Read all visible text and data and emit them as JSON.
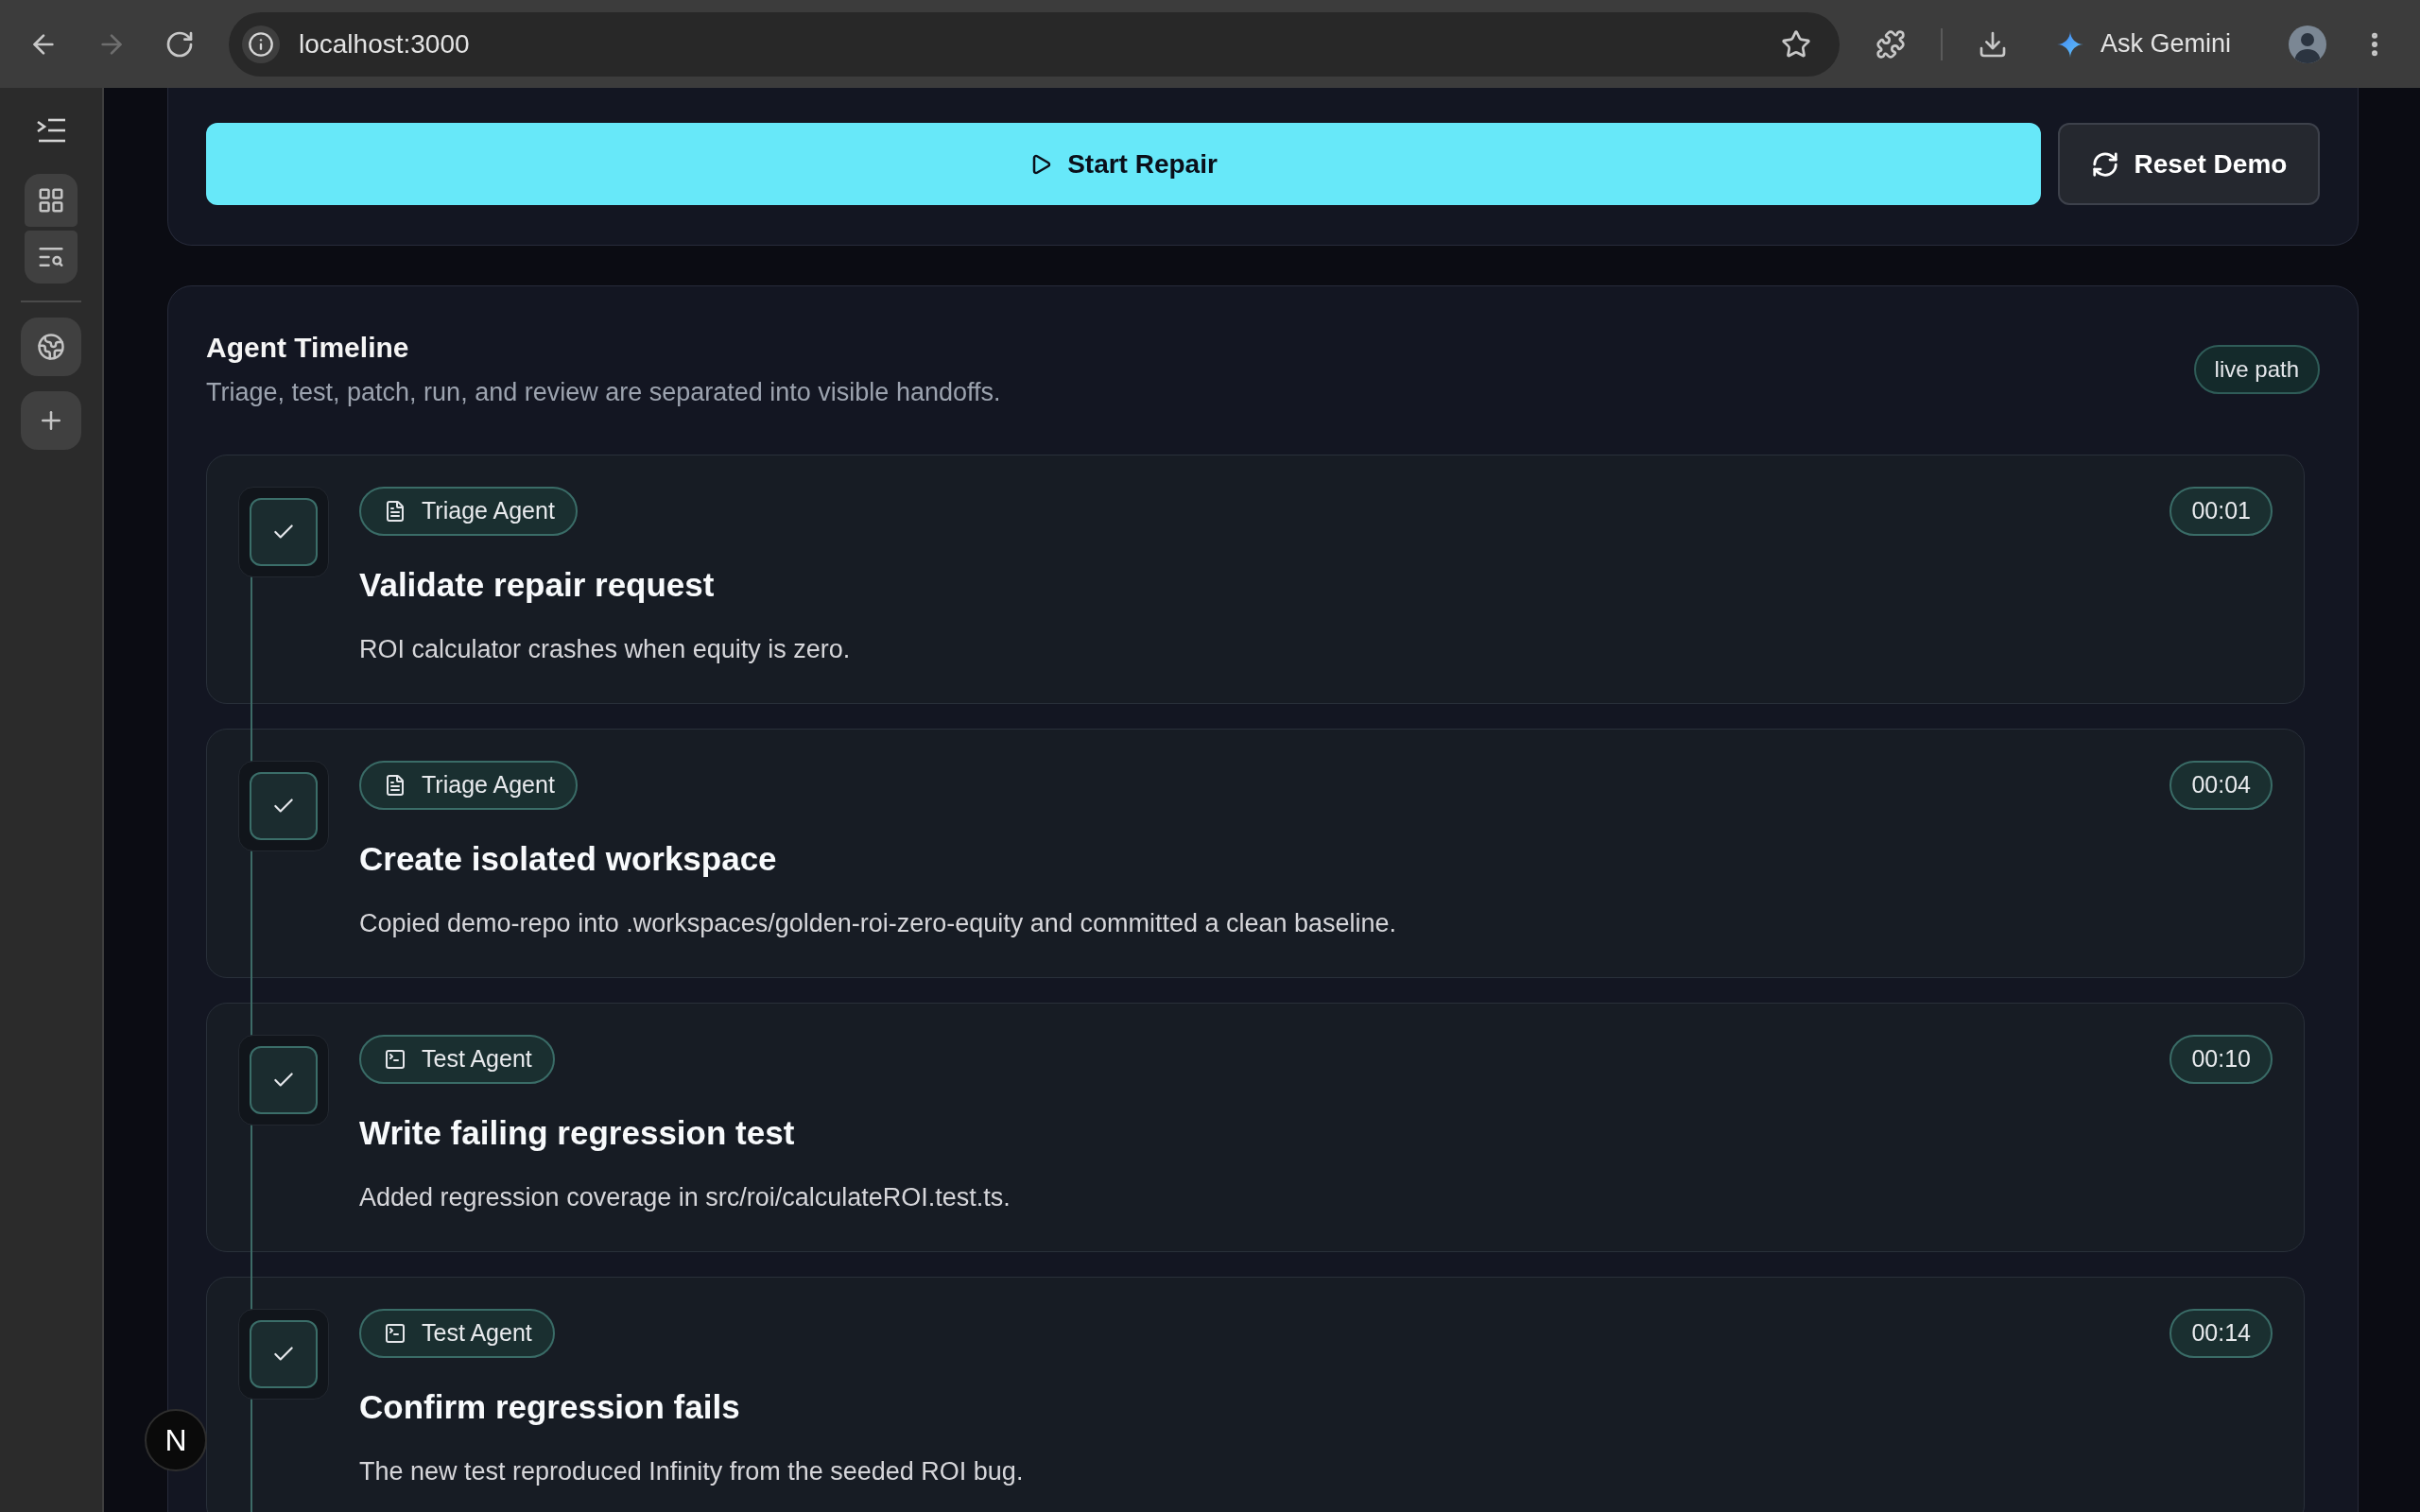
{
  "browser": {
    "nav": [
      {
        "kind": "back",
        "disabled": false
      },
      {
        "kind": "forward",
        "disabled": true
      },
      {
        "kind": "reload",
        "disabled": false
      }
    ],
    "address": "localhost:3000",
    "assistant_label": "Ask Gemini"
  },
  "side_panel": {
    "pinned": [
      {
        "kind": "grid"
      },
      {
        "kind": "search"
      }
    ],
    "apps": [
      {
        "kind": "globe"
      },
      {
        "kind": "add"
      }
    ]
  },
  "controls": [
    {
      "kind": "start",
      "label": "Start Repair"
    },
    {
      "kind": "reset",
      "label": "Reset Demo"
    }
  ],
  "timeline": {
    "title": "Agent Timeline",
    "subtitle": "Triage, test, patch, run, and review are separated into visible handoffs.",
    "badge": "live path",
    "steps": [
      {
        "agent": {
          "kind": "triage",
          "label": "Triage Agent"
        },
        "time": "00:01",
        "title": "Validate repair request",
        "description": "ROI calculator crashes when equity is zero.",
        "done": true
      },
      {
        "agent": {
          "kind": "triage",
          "label": "Triage Agent"
        },
        "time": "00:04",
        "title": "Create isolated workspace",
        "description": "Copied demo-repo into .workspaces/golden-roi-zero-equity and committed a clean baseline.",
        "done": true
      },
      {
        "agent": {
          "kind": "test",
          "label": "Test Agent"
        },
        "time": "00:10",
        "title": "Write failing regression test",
        "description": "Added regression coverage in src/roi/calculateROI.test.ts.",
        "done": true
      },
      {
        "agent": {
          "kind": "test",
          "label": "Test Agent"
        },
        "time": "00:14",
        "title": "Confirm regression fails",
        "description": "The new test reproduced Infinity from the seeded ROI bug.",
        "done": true
      }
    ]
  },
  "dev_badge": "N"
}
